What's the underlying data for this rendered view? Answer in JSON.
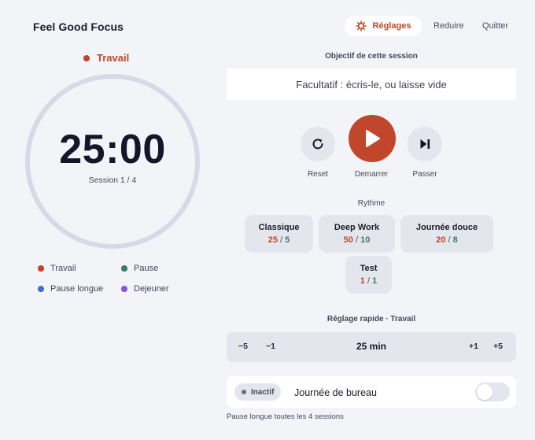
{
  "app": {
    "title": "Feel Good Focus"
  },
  "header": {
    "settings_label": "Réglages",
    "reduce_label": "Reduire",
    "quit_label": "Quitter"
  },
  "timer": {
    "mode_label": "Travail",
    "time": "25:00",
    "session_text": "Session 1 / 4"
  },
  "legend": [
    {
      "label": "Travail",
      "color": "#c0472b"
    },
    {
      "label": "Pause",
      "color": "#3a7d5c"
    },
    {
      "label": "Pause longue",
      "color": "#3f6fd0"
    },
    {
      "label": "Dejeuner",
      "color": "#8a55d6"
    }
  ],
  "objective": {
    "title": "Objectif de cette session",
    "placeholder": "Facultatif : écris-le, ou laisse vide",
    "value": ""
  },
  "controls": {
    "reset_label": "Reset",
    "start_label": "Demarrer",
    "skip_label": "Passer"
  },
  "rhythm": {
    "title": "Rythme",
    "presets": [
      {
        "name": "Classique",
        "work": "25",
        "sep": " / ",
        "pause": "5"
      },
      {
        "name": "Deep Work",
        "work": "50",
        "sep": " / ",
        "pause": "10"
      },
      {
        "name": "Journée douce",
        "work": "20",
        "sep": " / ",
        "pause": "8"
      },
      {
        "name": "Test",
        "work": "1",
        "sep": " / ",
        "pause": "1"
      }
    ]
  },
  "quick_adjust": {
    "title": "Réglage rapide · Travail",
    "minus5": "−5",
    "minus1": "−1",
    "value": "25 min",
    "plus1": "+1",
    "plus5": "+5"
  },
  "office": {
    "badge": "Inactif",
    "label": "Journée de bureau",
    "enabled": false
  },
  "footer": {
    "note": "Pause longue toutes les 4 sessions"
  },
  "colors": {
    "accent": "#c0472b",
    "pause": "#3a7d5c",
    "long_pause": "#3f6fd0",
    "lunch": "#8a55d6"
  }
}
